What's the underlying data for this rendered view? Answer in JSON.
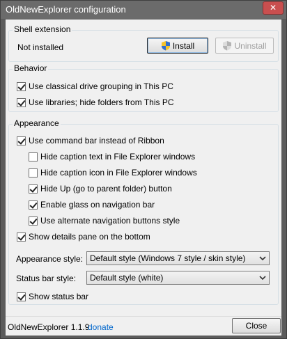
{
  "window": {
    "title": "OldNewExplorer configuration",
    "close_glyph": "✕"
  },
  "shell": {
    "group_label": "Shell extension",
    "status": "Not installed",
    "install_label": "Install",
    "uninstall_label": "Uninstall"
  },
  "behavior": {
    "group_label": "Behavior",
    "options": [
      {
        "label": "Use classical drive grouping in This PC",
        "checked": true
      },
      {
        "label": "Use libraries; hide folders from This PC",
        "checked": true
      }
    ]
  },
  "appearance": {
    "group_label": "Appearance",
    "options": [
      {
        "label": "Use command bar instead of Ribbon",
        "checked": true
      },
      {
        "label": "Hide caption text in File Explorer windows",
        "checked": false
      },
      {
        "label": "Hide caption icon in File Explorer windows",
        "checked": false
      },
      {
        "label": "Hide Up (go to parent folder) button",
        "checked": true
      },
      {
        "label": "Enable glass on navigation bar",
        "checked": true
      },
      {
        "label": "Use alternate navigation buttons style",
        "checked": true
      },
      {
        "label": "Show details pane on the bottom",
        "checked": true
      }
    ],
    "style_label": "Appearance style:",
    "style_value": "Default style (Windows 7 style / skin style)",
    "statusbar_label": "Status bar style:",
    "statusbar_value": "Default style (white)",
    "show_statusbar": {
      "label": "Show status bar",
      "checked": true
    }
  },
  "footer": {
    "version": "OldNewExplorer 1.1.9",
    "donate": "donate",
    "close_label": "Close"
  },
  "colors": {
    "titlebar": "#6b6b6b",
    "frame": "#5c5c5c",
    "client": "#f0f0f0",
    "link": "#0066cc",
    "close": "#c94f4f"
  }
}
